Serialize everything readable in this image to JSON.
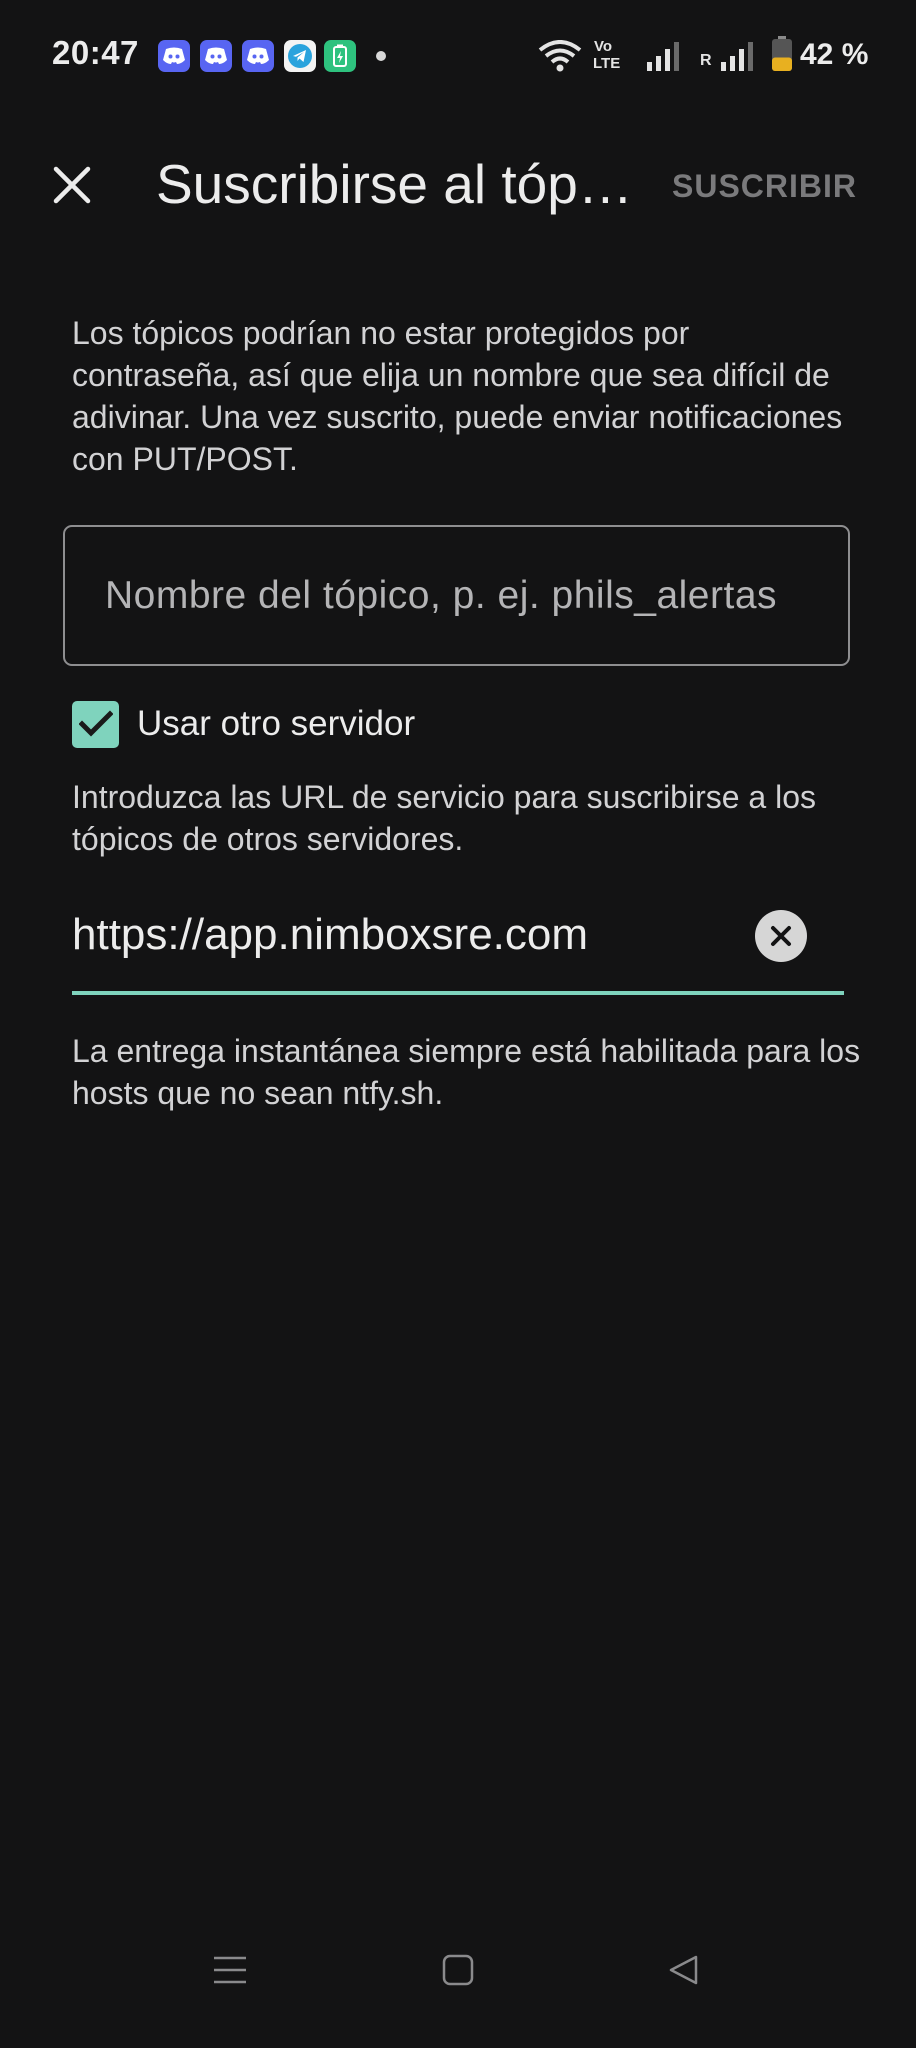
{
  "status_bar": {
    "time": "20:47",
    "battery_percent": "42 %",
    "battery_level": 0.42,
    "notification_icons": [
      "discord-icon",
      "discord-icon",
      "discord-icon",
      "telegram-icon",
      "battery-saver-icon"
    ],
    "system_icons": [
      "wifi-icon",
      "volte-icon",
      "signal-icon",
      "roaming-signal-icon",
      "battery-icon"
    ],
    "volte_label": "Vo",
    "lte_label": "LTE",
    "roaming_label": "R"
  },
  "app_bar": {
    "close_icon": "close-icon",
    "title": "Suscribirse al tópico",
    "action_label": "SUSCRIBIR"
  },
  "form": {
    "info_text": "Los tópicos podrían no estar protegidos por contraseña, así que elija un nombre que sea difícil de adivinar. Una vez suscrito, puede enviar notificaciones con PUT/POST.",
    "topic_placeholder": "Nombre del tópico, p. ej. phils_alertas",
    "topic_value": "",
    "use_other_server_label": "Usar otro servidor",
    "use_other_server_checked": true,
    "server_help": "Introduzca las URL de servicio para suscribirse a los tópicos de otros servidores.",
    "server_url": "https://app.nimboxsre.com",
    "delivery_note": "La entrega instantánea siempre está habilitada para los hosts que no sean ntfy.sh."
  },
  "nav_bar": {
    "icons": [
      "menu-icon",
      "home-icon",
      "back-icon"
    ]
  },
  "colors": {
    "background": "#131314",
    "accent": "#7fd3bd",
    "text_primary": "#ececec",
    "text_secondary": "#d2d2d4",
    "action_disabled": "#7a7a7c",
    "discord": "#5865f2",
    "telegram": "#2aa3dd",
    "battery_fill": "#e8b020"
  }
}
